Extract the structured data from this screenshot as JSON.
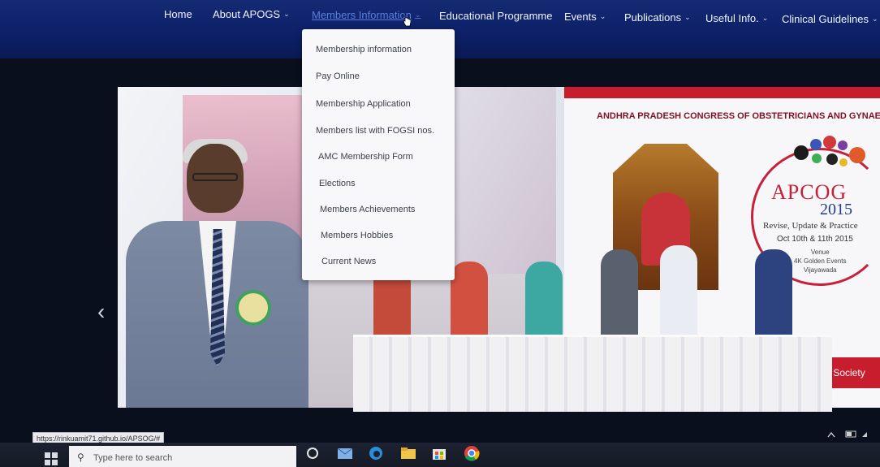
{
  "nav": {
    "items": [
      {
        "label": "Home",
        "chevron": false
      },
      {
        "label": "About APOGS",
        "chevron": true
      },
      {
        "label": "Members Information",
        "chevron": true,
        "active": true
      },
      {
        "label": "Educational Programme",
        "chevron": false
      },
      {
        "label": "Events",
        "chevron": true
      },
      {
        "label": "Publications",
        "chevron": true
      },
      {
        "label": "Useful Info.",
        "chevron": true
      },
      {
        "label": "Clinical Guidelines",
        "chevron": true
      }
    ]
  },
  "dropdown": {
    "items": [
      "Membership information",
      "Pay Online",
      "Membership Application",
      "Members list with FOGSI nos.",
      "AMC Membership Form",
      "Elections",
      "Members Achievements",
      "Members Hobbies",
      "Current News"
    ]
  },
  "slide": {
    "banner_title": "ANDHRA PRADESH CONGRESS OF OBSTETRICIANS AND GYNAECOLO",
    "logo_text": "APCOG",
    "logo_year": "2015",
    "tagline": "Revise, Update & Practice",
    "dates": "Oct 10th & 11th 2015",
    "venue_label": "Venue",
    "venue_name": "4K Golden Events",
    "venue_city": "Vijayawada",
    "society_text": "ical Society",
    "prev_arrow": "‹"
  },
  "status_url": "https://rinkuamit71.github.io/APSOG/#",
  "taskbar": {
    "search_placeholder": "Type here to search"
  },
  "colors": {
    "nav_bg": "#0d2068",
    "accent_red": "#c81d2c",
    "link_active": "#5a7fe0"
  }
}
